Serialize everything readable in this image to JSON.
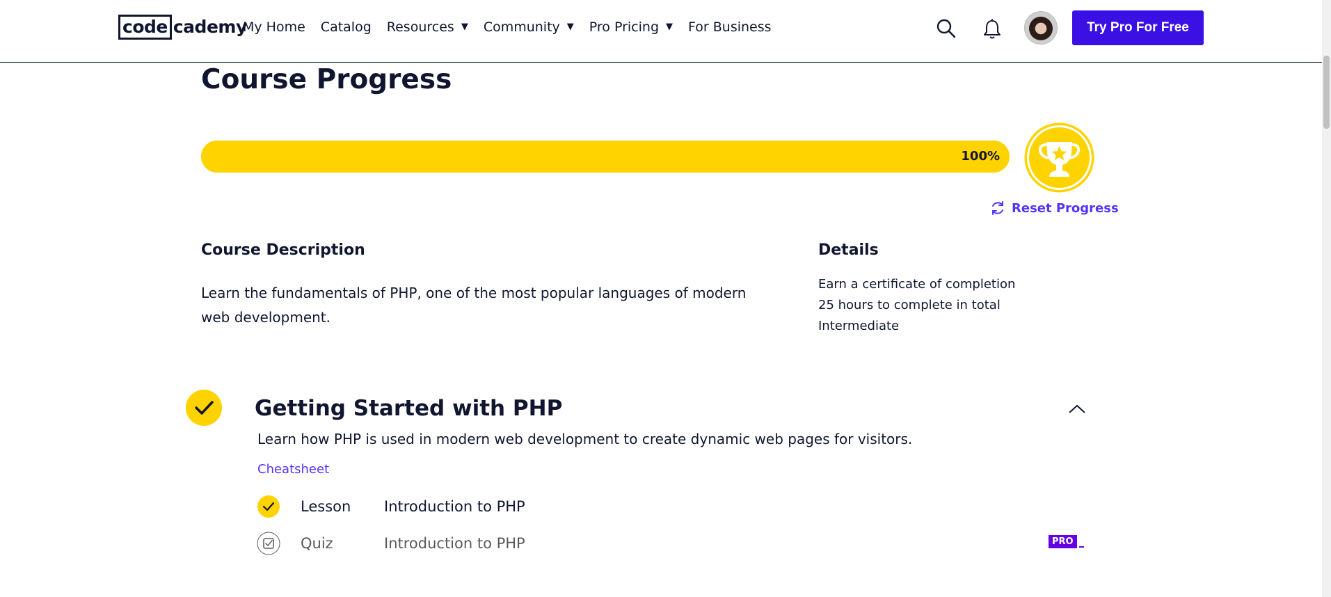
{
  "header": {
    "logo": {
      "part1": "code",
      "part2": "cademy"
    },
    "nav": [
      {
        "label": "My Home",
        "dropdown": false
      },
      {
        "label": "Catalog",
        "dropdown": false
      },
      {
        "label": "Resources",
        "dropdown": true
      },
      {
        "label": "Community",
        "dropdown": true
      },
      {
        "label": "Pro Pricing",
        "dropdown": true
      },
      {
        "label": "For Business",
        "dropdown": false
      }
    ],
    "caret": "▼",
    "cta_label": "Try Pro For Free"
  },
  "course": {
    "title": "Course Progress",
    "progress_percent": 100,
    "progress_label": "100%",
    "reset_label": "Reset Progress",
    "description_heading": "Course Description",
    "description": "Learn the fundamentals of PHP, one of the most popular languages of modern web development.",
    "details_heading": "Details",
    "details": [
      "Earn a certificate of completion",
      "25 hours to complete in total",
      "Intermediate"
    ]
  },
  "module": {
    "title": "Getting Started with PHP",
    "description": "Learn how PHP is used in modern web development to create dynamic web pages for visitors.",
    "cheatsheet_label": "Cheatsheet",
    "items": [
      {
        "type": "Lesson",
        "name": "Introduction to PHP",
        "completed": true
      },
      {
        "type": "Quiz",
        "name": "Introduction to PHP",
        "completed": false
      }
    ],
    "pro_badge": "PRO"
  },
  "colors": {
    "accent_yellow": "#ffd300",
    "brand_purple": "#3a10e5",
    "link_purple": "#5533ff",
    "navy": "#10162f"
  },
  "icons": [
    "search-icon",
    "bell-icon",
    "trophy-icon",
    "reset-icon",
    "check-icon",
    "chevron-up-icon",
    "quiz-icon"
  ]
}
